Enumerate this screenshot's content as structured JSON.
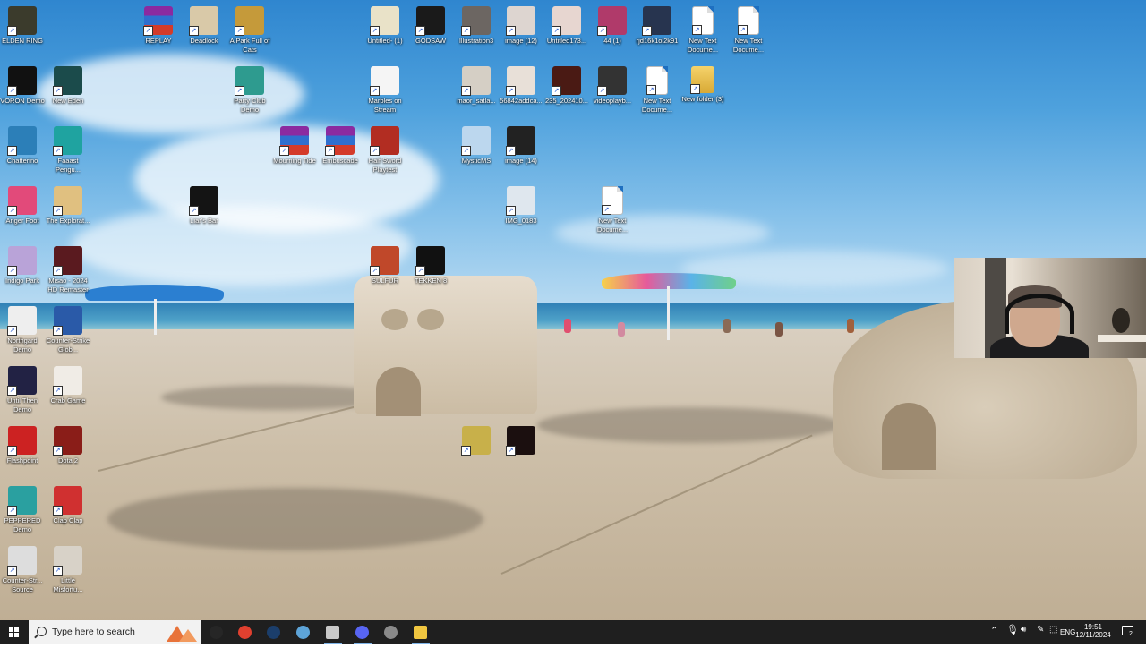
{
  "desktop": {
    "icons": [
      {
        "label": "ELDEN RING",
        "color": "#3b3b2c"
      },
      {
        "label": "REPLAY",
        "color": "#8b2aa0"
      },
      {
        "label": "Deadlock",
        "color": "#d9c9a8"
      },
      {
        "label": "A Park Full of Cats",
        "color": "#c59a3a"
      },
      {
        "label": "Untitled- (1)",
        "color": "#e9e2c8"
      },
      {
        "label": "GODSAW",
        "color": "#1a1a1a"
      },
      {
        "label": "Illustration3",
        "color": "#6c6662"
      },
      {
        "label": "image (12)",
        "color": "#ddd5d0"
      },
      {
        "label": "Untitled173...",
        "color": "#e7d6d0"
      },
      {
        "label": "44 (1)",
        "color": "#b03a6a"
      },
      {
        "label": "rjd16k1ol2k91",
        "color": "#27344f"
      },
      {
        "label": "New Text Docume...",
        "color": "#ffffff"
      },
      {
        "label": "New Text Docume...",
        "color": "#ffffff"
      },
      {
        "label": "VORON Demo",
        "color": "#111111"
      },
      {
        "label": "New Eden",
        "color": "#1b4b4b"
      },
      {
        "label": "Party Club Demo",
        "color": "#2e9b8f"
      },
      {
        "label": "Marbles on Stream",
        "color": "#f5f5f5"
      },
      {
        "label": "maor_satla...",
        "color": "#d5cfc5"
      },
      {
        "label": "56842addca...",
        "color": "#e8e0d8"
      },
      {
        "label": "235_202410...",
        "color": "#4a1a14"
      },
      {
        "label": "videoplayb...",
        "color": "#333333"
      },
      {
        "label": "New Text Docume...",
        "color": "#ffffff"
      },
      {
        "label": "New folder (3)",
        "color": "#e8c35a"
      },
      {
        "label": "Chatterino",
        "color": "#2c7fb8"
      },
      {
        "label": "Faaast Pengu...",
        "color": "#1fa3a0"
      },
      {
        "label": "Mourning Tide",
        "color": "#8b2aa0"
      },
      {
        "label": "Embuscade",
        "color": "#8b2aa0"
      },
      {
        "label": "Half Sword Playtest",
        "color": "#b22d22"
      },
      {
        "label": "MysticMS",
        "color": "#bcd7ee"
      },
      {
        "label": "image (14)",
        "color": "#222222"
      },
      {
        "label": "Anger Foot",
        "color": "#e24a7a"
      },
      {
        "label": "The Explorat...",
        "color": "#e0c080"
      },
      {
        "label": "Liar's Bar",
        "color": "#141414"
      },
      {
        "label": "IMG_0183",
        "color": "#dfe7ee"
      },
      {
        "label": "New Text Docume...",
        "color": "#ffffff"
      },
      {
        "label": "Indigo Park",
        "color": "#b9a3d8"
      },
      {
        "label": "Misao - 2024 HD Remaster",
        "color": "#5a1a1f"
      },
      {
        "label": "SULFUR",
        "color": "#c0482a"
      },
      {
        "label": "TEKKEN 8",
        "color": "#111111"
      },
      {
        "label": "Northgard Demo",
        "color": "#eeeeee"
      },
      {
        "label": "Counter-Strike Glob...",
        "color": "#2a5aa8"
      },
      {
        "label": "Until Then Demo",
        "color": "#222244"
      },
      {
        "label": "Crab Game",
        "color": "#f0ece6"
      },
      {
        "label": "Flashpoint",
        "color": "#cc2222"
      },
      {
        "label": "Dota 2",
        "color": "#8a1d18"
      },
      {
        "label": "",
        "color": "#c8b04a"
      },
      {
        "label": "",
        "color": "#1b0f0f"
      },
      {
        "label": "PEPPERED Demo",
        "color": "#2aa0a0"
      },
      {
        "label": "Clap Clap",
        "color": "#d03030"
      },
      {
        "label": "Counter-Str... Source",
        "color": "#dddddd"
      },
      {
        "label": "Little Misfortu...",
        "color": "#d8d2c8"
      }
    ]
  },
  "taskbar": {
    "search_placeholder": "Type here to search",
    "apps": [
      {
        "name": "obs-icon",
        "color": "#262626"
      },
      {
        "name": "chrome-icon",
        "color": "#e0402f"
      },
      {
        "name": "steam-icon",
        "color": "#1b3e6b"
      },
      {
        "name": "chatterino-icon",
        "color": "#5da4d8"
      },
      {
        "name": "notes-icon",
        "color": "#c9c9c9"
      },
      {
        "name": "discord-icon",
        "color": "#5865f2"
      },
      {
        "name": "app-icon",
        "color": "#8a8a8a"
      },
      {
        "name": "file-explorer-icon",
        "color": "#f0c640"
      }
    ],
    "tray": {
      "language": "ENG",
      "time": "19:51",
      "date": "12/11/2024"
    }
  }
}
